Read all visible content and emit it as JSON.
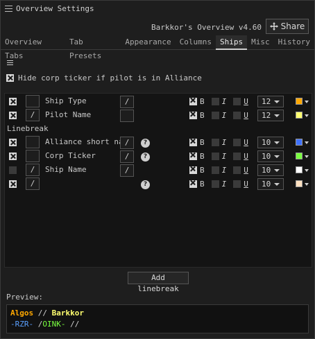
{
  "window": {
    "title": "Overview Settings"
  },
  "header": {
    "overview_name": "Barkkor's Overview v4.60",
    "share_label": "Share"
  },
  "tabs": [
    {
      "label": "Overview Tabs",
      "active": false
    },
    {
      "label": "Tab Presets",
      "active": false
    },
    {
      "label": "Appearance",
      "active": false
    },
    {
      "label": "Columns",
      "active": false
    },
    {
      "label": "Ships",
      "active": true
    },
    {
      "label": "Misc",
      "active": false
    },
    {
      "label": "History",
      "active": false
    }
  ],
  "options": {
    "hide_corp_ticker": {
      "label": "Hide corp ticker if pilot is in Alliance",
      "checked": true
    }
  },
  "label_rows": {
    "linebreak_label": "Linebreak",
    "rows": [
      {
        "enabled": true,
        "prefix": "",
        "label": "Ship Type",
        "suffix": "/",
        "help": false,
        "bold": true,
        "italic": false,
        "underline": false,
        "size": "12",
        "color": "#ffa800"
      },
      {
        "enabled": true,
        "prefix": "/",
        "label": "Pilot Name",
        "suffix": "",
        "help": false,
        "bold": true,
        "italic": false,
        "underline": false,
        "size": "12",
        "color": "#ffff70"
      },
      {
        "enabled": true,
        "prefix": "",
        "label": "Alliance short name",
        "suffix": "/",
        "help": true,
        "bold": true,
        "italic": false,
        "underline": false,
        "size": "10",
        "color": "#3f72ff"
      },
      {
        "enabled": true,
        "prefix": "",
        "label": "Corp Ticker",
        "suffix": "/",
        "help": true,
        "bold": true,
        "italic": false,
        "underline": false,
        "size": "10",
        "color": "#7aff40"
      },
      {
        "enabled": false,
        "prefix": "/",
        "label": "Ship Name",
        "suffix": "/",
        "help": false,
        "bold": true,
        "italic": false,
        "underline": false,
        "size": "10",
        "color": "#ffffff"
      },
      {
        "enabled": true,
        "prefix": "/",
        "label": "",
        "suffix": "",
        "help": true,
        "bold": true,
        "italic": false,
        "underline": false,
        "size": "10",
        "color": "#ffe0c0"
      }
    ],
    "format_letters": {
      "bold": "B",
      "italic": "I",
      "underline": "U"
    },
    "help_glyph": "?"
  },
  "buttons": {
    "add_linebreak": "Add linebreak"
  },
  "preview": {
    "label": "Preview:",
    "line1": {
      "ship": "Algos",
      "sep": " // ",
      "pilot": "Barkkor"
    },
    "line2": {
      "alliance": "-RZR-",
      "sep1": " /",
      "corp": "OINK-",
      "sep2": " //"
    }
  }
}
